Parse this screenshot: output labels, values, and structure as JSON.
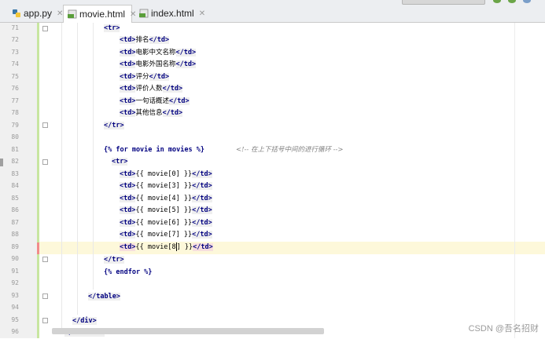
{
  "tabs": [
    {
      "label": "app.py",
      "icon": "python-file-icon",
      "active": false
    },
    {
      "label": "movie.html",
      "icon": "html-file-icon",
      "active": true
    },
    {
      "label": "index.html",
      "icon": "html-file-icon",
      "active": false
    }
  ],
  "editor": {
    "line_numbers": [
      "71",
      "72",
      "73",
      "74",
      "75",
      "76",
      "77",
      "78",
      "79",
      "80",
      "81",
      "82",
      "83",
      "84",
      "85",
      "86",
      "87",
      "88",
      "89",
      "90",
      "91",
      "92",
      "93",
      "94",
      "95",
      "96"
    ],
    "lines": {
      "l71": {
        "open": "<tr>"
      },
      "l72": {
        "open": "<td>",
        "text": "排名",
        "close": "</td>"
      },
      "l73": {
        "open": "<td>",
        "text": "电影中文名称",
        "close": "</td>"
      },
      "l74": {
        "open": "<td>",
        "text": "电影外国名称",
        "close": "</td>"
      },
      "l75": {
        "open": "<td>",
        "text": "评分",
        "close": "</td>"
      },
      "l76": {
        "open": "<td>",
        "text": "评价人数",
        "close": "</td>"
      },
      "l77": {
        "open": "<td>",
        "text": "一句话概述",
        "close": "</td>"
      },
      "l78": {
        "open": "<td>",
        "text": "其他信息",
        "close": "</td>"
      },
      "l79": {
        "close": "</tr>"
      },
      "l81": {
        "tpl": "{% for movie in movies %}",
        "comment": "<!-- 在上下括号中间的进行循环 -->"
      },
      "l82": {
        "open": "<tr>"
      },
      "l83": {
        "open": "<td>",
        "text": "{{ movie[0] }}",
        "close": "</td>"
      },
      "l84": {
        "open": "<td>",
        "text": "{{ movie[3] }}",
        "close": "</td>"
      },
      "l85": {
        "open": "<td>",
        "text": "{{ movie[4] }}",
        "close": "</td>"
      },
      "l86": {
        "open": "<td>",
        "text": "{{ movie[5] }}",
        "close": "</td>"
      },
      "l87": {
        "open": "<td>",
        "text": "{{ movie[6] }}",
        "close": "</td>"
      },
      "l88": {
        "open": "<td>",
        "text": "{{ movie[7] }}",
        "close": "</td>"
      },
      "l89": {
        "open": "<td>",
        "text_a": "{{ movie[8",
        "text_b": "] }}",
        "close": "</td>"
      },
      "l90": {
        "close": "</tr>"
      },
      "l91": {
        "tpl": "{% endfor %}"
      },
      "l93": {
        "close": "</table>"
      },
      "l95": {
        "close": "</div>"
      },
      "l96": {
        "open": "</section>",
        "comment": "<!-- End Counts Section -->"
      }
    }
  },
  "watermark": "CSDN @吾名招财",
  "colors": {
    "tag": "#000080",
    "comment": "#808080",
    "caret_line": "#fdf8da",
    "change_bar": "#c8e6a0"
  }
}
